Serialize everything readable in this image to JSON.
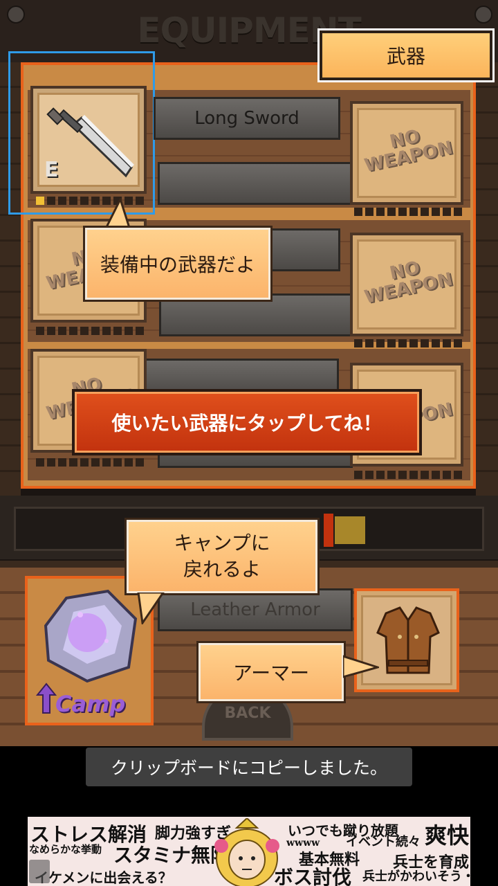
{
  "screen_title": "EQUIPMENT",
  "tab": {
    "label": "武器"
  },
  "weapons": {
    "equipped": {
      "name": "Long Sword",
      "badge": "E"
    },
    "empty_label_line1": "NO",
    "empty_label_line2": "WEAPON"
  },
  "tooltips": {
    "equipped_weapon": "装備中の武器だよ",
    "tap_weapon": "使いたい武器にタップしてね！",
    "back_to_camp_line1": "キャンプに",
    "back_to_camp_line2": "戻れるよ",
    "armor": "アーマー"
  },
  "armor": {
    "name": "Leather Armor"
  },
  "camp_button": {
    "label": "Camp"
  },
  "back_button": {
    "label": "BACK"
  },
  "toast": {
    "message": "クリップボードにコピーしました。"
  },
  "ad": {
    "texts": [
      "ストレス解消",
      "脚力強すぎ",
      "いつでも蹴り放題",
      "爽快",
      "なめらかな挙動",
      "スタミナ無限",
      "wwww",
      "イベント続々",
      "基本無料",
      "兵士を育成",
      "イケメンに出会える？",
      "ボス討伐",
      "兵士がかわいそう・"
    ]
  },
  "colors": {
    "accent_orange": "#e9621b",
    "highlight_blue": "#2f9be8",
    "tab_fill": "#fbb45b"
  }
}
